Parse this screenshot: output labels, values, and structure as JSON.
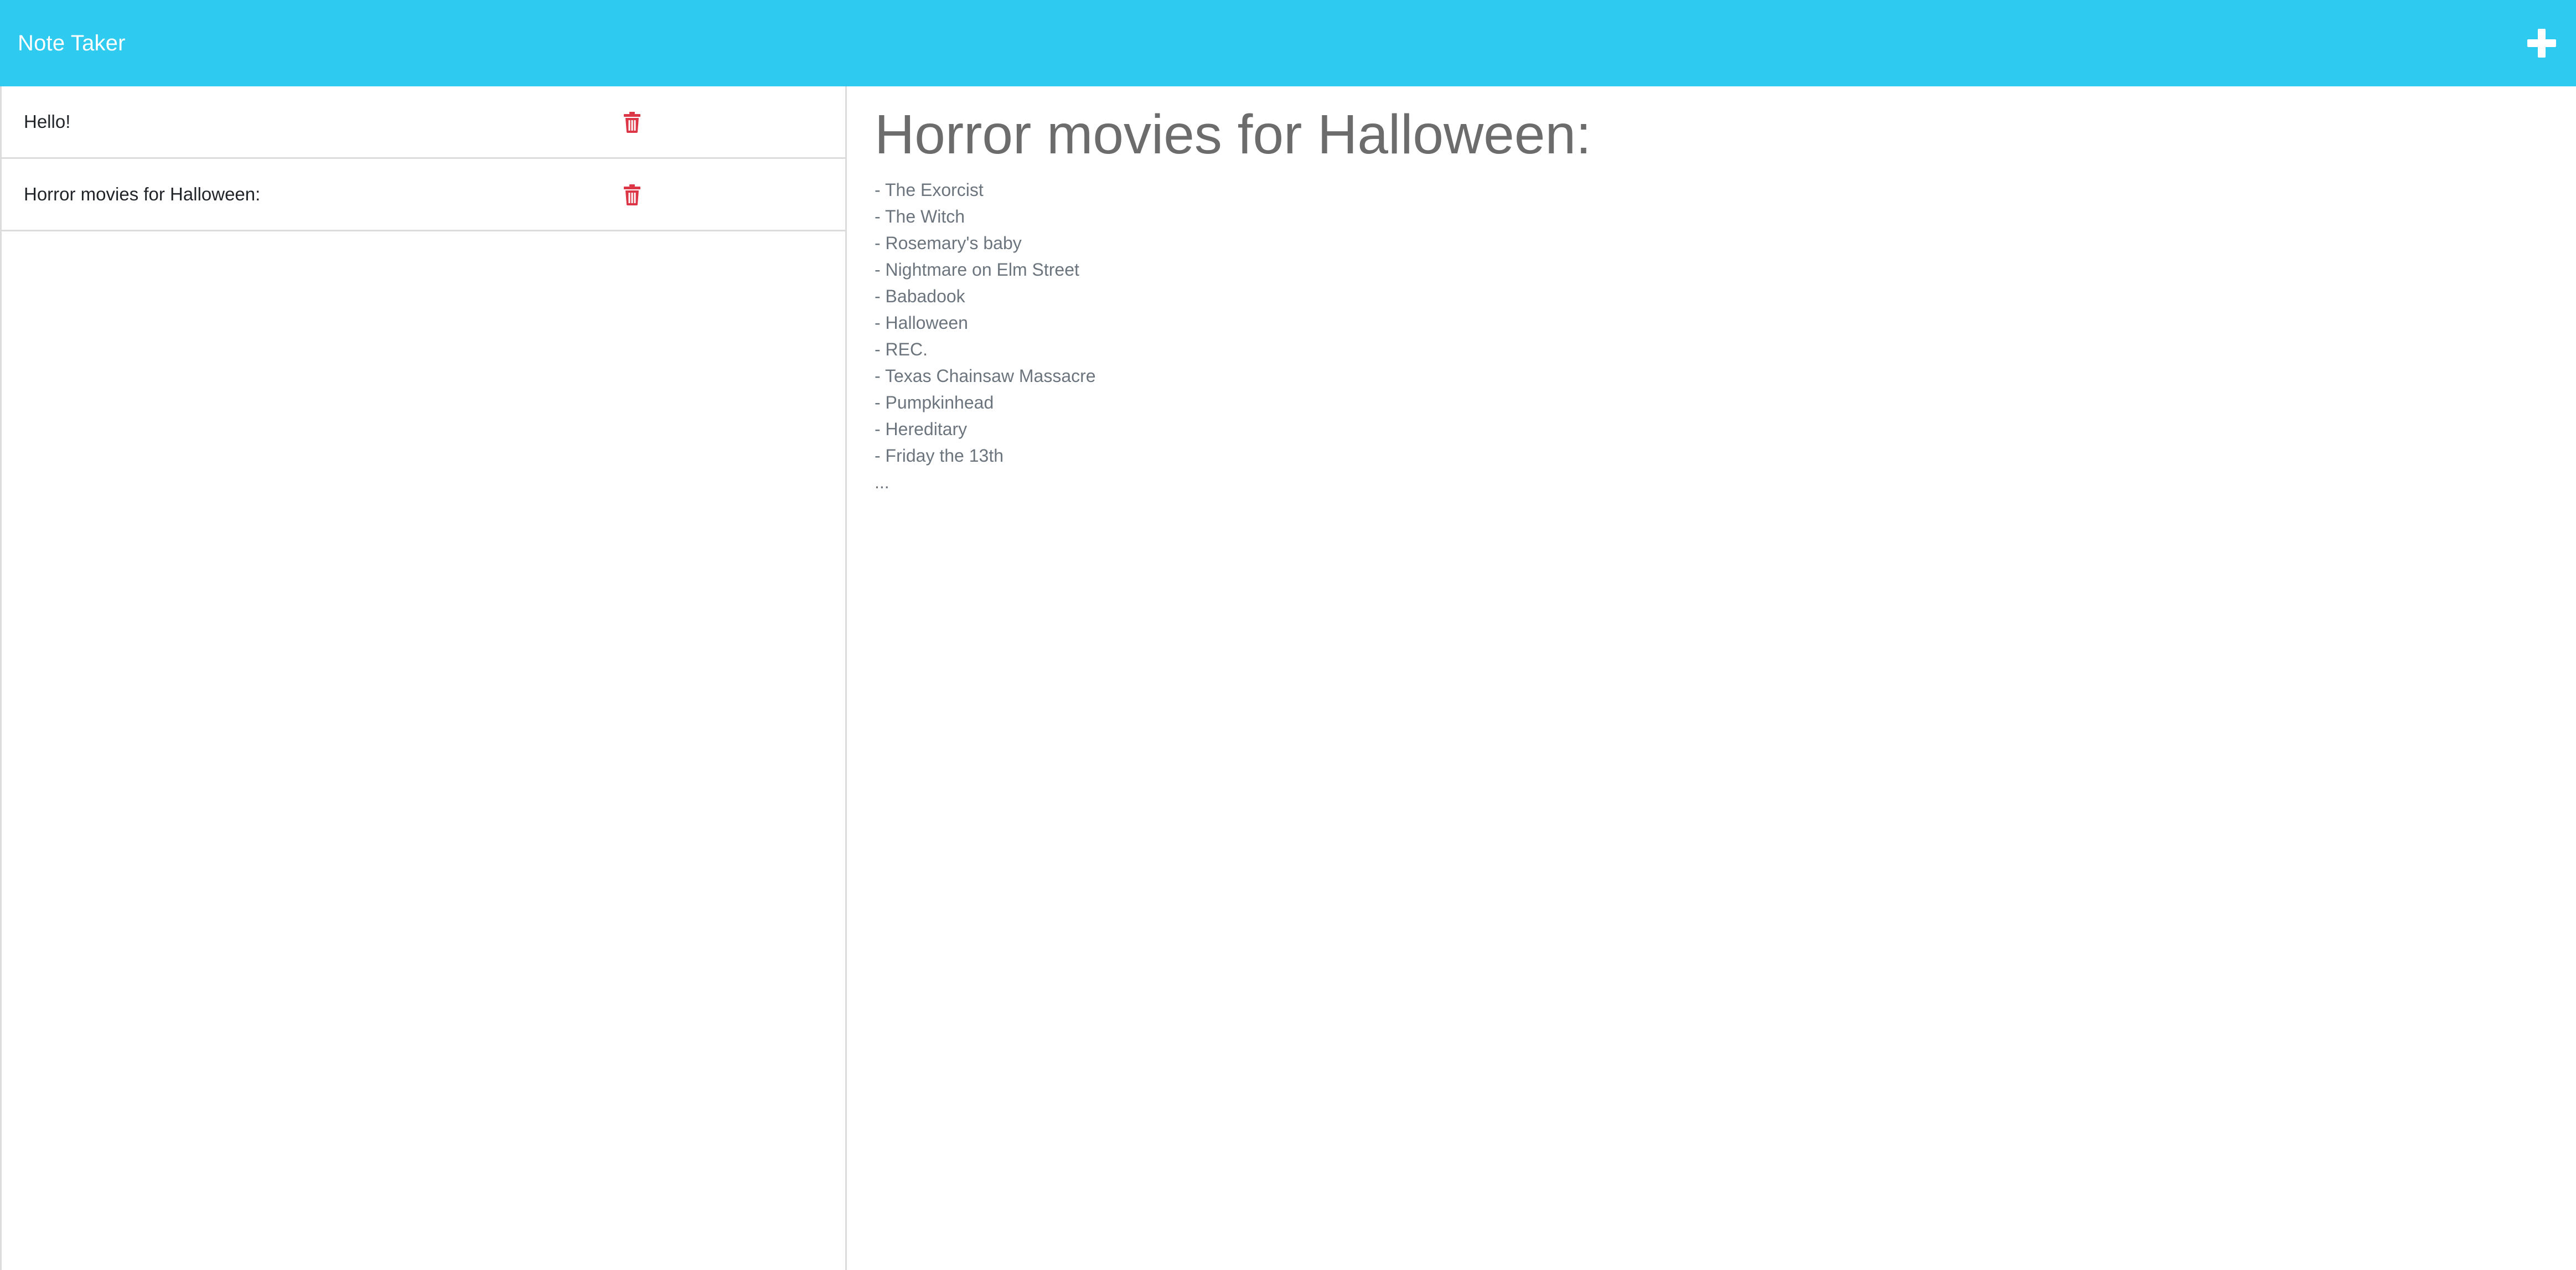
{
  "navbar": {
    "brand": "Note Taker",
    "new_note_icon": "plus-icon"
  },
  "notes": [
    {
      "title": "Hello!",
      "delete_icon": "trash-icon"
    },
    {
      "title": "Horror movies for Halloween:",
      "delete_icon": "trash-icon"
    }
  ],
  "active_note": {
    "title": "Horror movies for Halloween:",
    "lines": [
      "- The Exorcist",
      "- The Witch",
      "- Rosemary's baby",
      "- Nightmare on Elm Street",
      "- Babadook",
      "- Halloween",
      "- REC.",
      "- Texas Chainsaw Massacre",
      "- Pumpkinhead",
      "- Hereditary",
      "- Friday the 13th",
      "..."
    ]
  },
  "colors": {
    "navbar": "#2ecaf0",
    "delete": "#dc3545",
    "text_muted": "#6c757d"
  }
}
